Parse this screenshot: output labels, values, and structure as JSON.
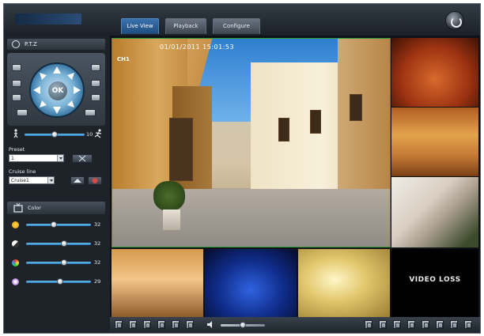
{
  "header": {
    "logo_text": "",
    "tabs": [
      {
        "label": "Live View",
        "active": true
      },
      {
        "label": "Playback",
        "active": false
      },
      {
        "label": "Configure",
        "active": false
      }
    ]
  },
  "ptz": {
    "title": "P.T.Z",
    "ok_label": "OK",
    "speed_value": "10",
    "preset_label": "Preset",
    "preset_value": "1",
    "cruise_label": "Cruise line",
    "cruise_value": "Cruise1"
  },
  "color": {
    "title": "Color",
    "brightness": "32",
    "contrast": "32",
    "saturation": "32",
    "hue": "29"
  },
  "video": {
    "main_timestamp": "01/01/2011 15:01:53",
    "main_channel": "CH1",
    "tile_overlays": [
      "",
      "",
      "",
      "",
      "",
      "",
      ""
    ],
    "video_loss_text": "VIDEO LOSS"
  },
  "colors": {
    "active_tab": "#2f639b",
    "selected_border": "#2b9a3b"
  }
}
